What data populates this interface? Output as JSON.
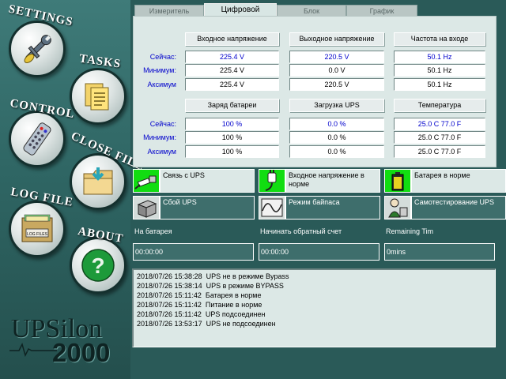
{
  "nav": {
    "settings": "SETTINGS",
    "tasks": "TASKS",
    "control": "CONTROL",
    "close_file": "CLOSE FILE",
    "log_file": "LOG FILE",
    "log_files_card": "LOG FILES",
    "about": "ABOUT"
  },
  "logo": {
    "line1": "UPSilon",
    "line2": "2000"
  },
  "tabs": [
    {
      "label": "Измеритель",
      "active": false
    },
    {
      "label": "Цифровой",
      "active": true
    },
    {
      "label": "Блок",
      "active": false
    },
    {
      "label": "График",
      "active": false
    }
  ],
  "row_labels": {
    "now": "Сейчас:",
    "min": "Минимум:",
    "max": "Аксимум"
  },
  "group1": {
    "headers": [
      "Входное напряжение",
      "Выходное напряжение",
      "Частота на входе"
    ],
    "now": [
      "225.4 V",
      "220.5 V",
      "50.1 Hz"
    ],
    "min": [
      "225.4 V",
      "0.0 V",
      "50.1 Hz"
    ],
    "max": [
      "225.4 V",
      "220.5 V",
      "50.1 Hz"
    ]
  },
  "group2": {
    "headers": [
      "Заряд батареи",
      "Загрузка UPS",
      "Температура"
    ],
    "now": [
      "100 %",
      "0.0 %",
      "25.0 C  77.0 F"
    ],
    "min": [
      "100 %",
      "0.0 %",
      "25.0 C  77.0 F"
    ],
    "max": [
      "100 %",
      "0.0 %",
      "25.0 C  77.0 F"
    ]
  },
  "status": {
    "link": "Связь с UPS",
    "input_voltage": "Входное напряжение в норме",
    "battery": "Батарея в норме",
    "ups_fail": "Сбой UPS",
    "bypass": "Режим байпаса",
    "self_test": "Самотестирование UPS"
  },
  "counters": {
    "on_battery_label": "На батарея",
    "on_battery_value": "00:00:00",
    "countdown_label": "Начинать обратный счет",
    "countdown_value": "00:00:00",
    "remaining_label": "Remaining Tim",
    "remaining_value": "0mins"
  },
  "log": [
    "2018/07/26 15:38:28  UPS не в режиме Bypass",
    "2018/07/26 15:38:14  UPS в режиме BYPASS",
    "2018/07/26 15:11:42  Батарея в норме",
    "2018/07/26 15:11:42  Питание в норме",
    "2018/07/26 15:11:42  UPS подсоединен",
    "2018/07/26 13:53:17  UPS не подсоединен"
  ],
  "colors": {
    "status_green": "#11dd11",
    "value_blue": "#0000cc",
    "background_teal": "#2a5a58"
  }
}
